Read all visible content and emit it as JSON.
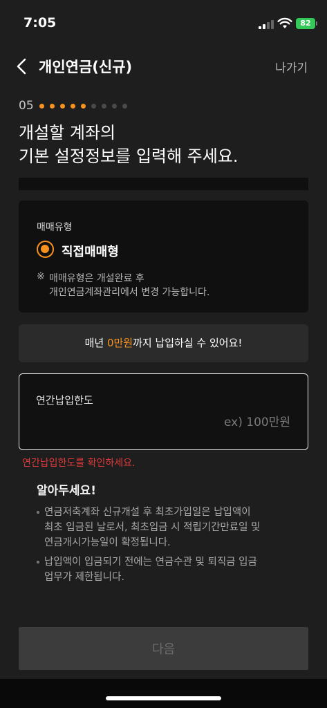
{
  "status_bar": {
    "time": "7:05",
    "battery": "82"
  },
  "header": {
    "title": "개인연금(신규)",
    "exit_label": "나가기"
  },
  "step": {
    "number": "05",
    "total_dots": 9,
    "active_dots": 5
  },
  "headline": "개설할 계좌의\n기본 설정정보를 입력해 주세요.",
  "trade_type": {
    "label": "매매유형",
    "option": "직접매매형",
    "note_mark": "※",
    "note_line1": "매매유형은 개설완료 후",
    "note_line2": "개인연금계좌관리에서 변경 가능합니다."
  },
  "banner": {
    "prefix": "매년 ",
    "amount": "0만원",
    "suffix": "까지 납입하실 수 있어요!"
  },
  "annual_limit": {
    "label": "연간납입한도",
    "value": "",
    "placeholder": "ex) 100만원"
  },
  "error": "연간납입한도를 확인하세요.",
  "notice": {
    "title": "알아두세요!",
    "items": [
      "연금저축계좌 신규개설 후 최초가입일은 납입액이\n최초 입금된 날로서, 최초입금 시 적립기간만료일 및\n연금개시가능일이 확정됩니다.",
      "납입액이 입금되기 전에는 연금수관 및 퇴직금 입금\n업무가 제한됩니다."
    ]
  },
  "next_label": "다음",
  "colors": {
    "accent": "#f7921e",
    "error": "#e03a3a",
    "background": "#1e1e1e"
  }
}
